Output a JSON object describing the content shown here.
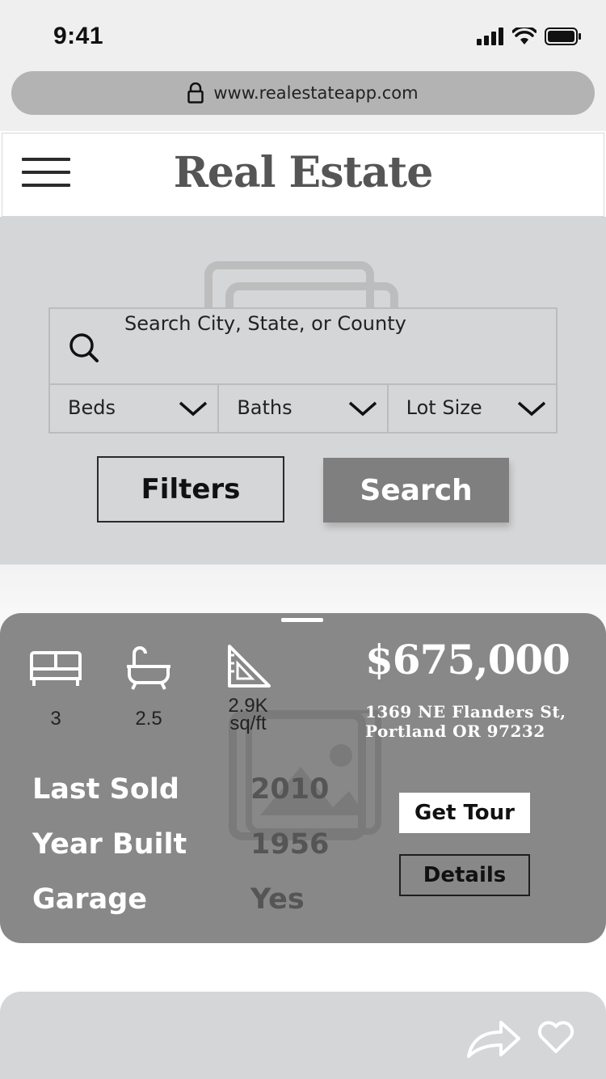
{
  "status_bar": {
    "time": "9:41",
    "icons": [
      "signal-icon",
      "wifi-icon",
      "battery-icon"
    ]
  },
  "browser": {
    "url": "www.realestateapp.com",
    "icon": "lock-icon"
  },
  "header": {
    "title": "Real Estate",
    "menu_icon": "hamburger-menu-icon"
  },
  "search": {
    "placeholder": "Search City, State, or County",
    "dropdowns": [
      {
        "label": "Beds"
      },
      {
        "label": "Baths"
      },
      {
        "label": "Lot Size"
      }
    ],
    "filters_label": "Filters",
    "search_label": "Search"
  },
  "listing": {
    "features": [
      {
        "icon": "bed-icon",
        "value": "3"
      },
      {
        "icon": "bathtub-icon",
        "value": "2.5"
      },
      {
        "icon": "ruler-triangle-icon",
        "value_line1": "2.9K",
        "value_line2": "sq/ft"
      }
    ],
    "price": "$675,000",
    "address_line1": "1369 NE Flanders St,",
    "address_line2": "Portland OR 97232",
    "facts": [
      {
        "label": "Last Sold",
        "value": "2010"
      },
      {
        "label": "Year Built",
        "value": "1956"
      },
      {
        "label": "Garage",
        "value": "Yes"
      }
    ],
    "tour_label": "Get Tour",
    "details_label": "Details"
  },
  "next_card": {
    "icons": [
      "share-icon",
      "heart-icon"
    ]
  },
  "colors": {
    "hero_bg": "#d5d6d8",
    "card_bg": "#888888",
    "search_button": "#7f7f7f",
    "url_bar": "#b3b3b3"
  }
}
